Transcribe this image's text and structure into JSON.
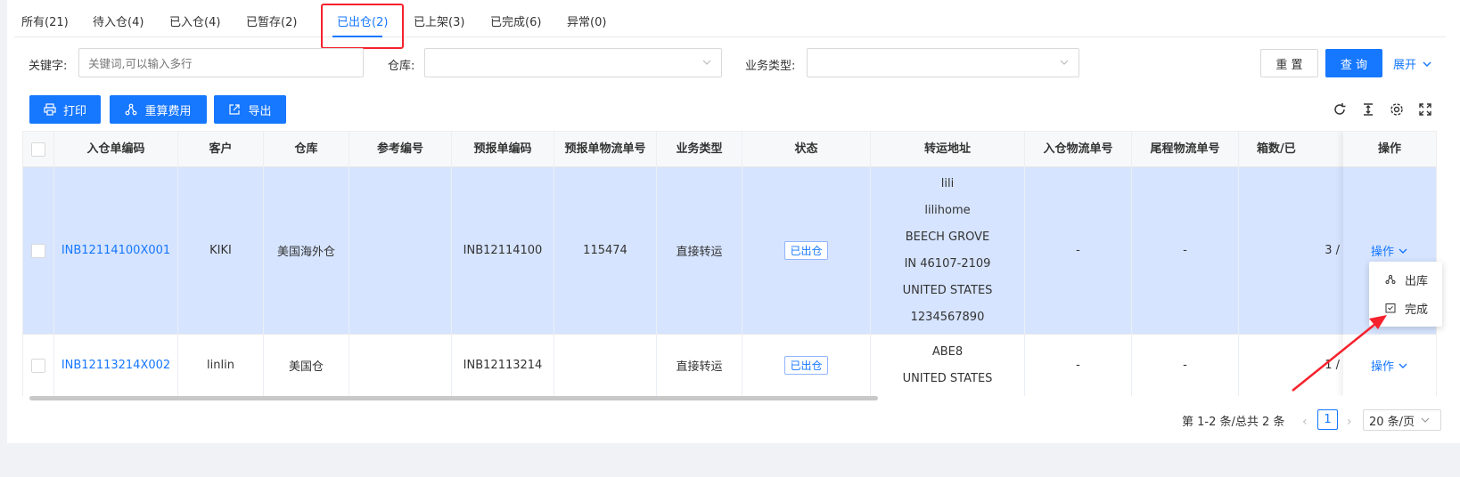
{
  "tabs": [
    {
      "label": "所有(21)"
    },
    {
      "label": "待入仓(4)"
    },
    {
      "label": "已入仓(4)"
    },
    {
      "label": "已暂存(2)"
    },
    {
      "label": "已出仓(2)"
    },
    {
      "label": "已上架(3)"
    },
    {
      "label": "已完成(6)"
    },
    {
      "label": "异常(0)"
    }
  ],
  "filters": {
    "keyword_label": "关键字:",
    "keyword_placeholder": "关键词,可以输入多行",
    "warehouse_label": "仓库:",
    "business_type_label": "业务类型:",
    "reset_label": "重 置",
    "query_label": "查 询",
    "expand_label": "展开"
  },
  "toolbar": {
    "print_label": "打印",
    "recalc_label": "重算费用",
    "export_label": "导出"
  },
  "table": {
    "columns": [
      "入仓单编码",
      "客户",
      "仓库",
      "参考编号",
      "预报单编码",
      "预报单物流单号",
      "业务类型",
      "状态",
      "转运地址",
      "入仓物流单号",
      "尾程物流单号",
      "箱数/已",
      "操作"
    ],
    "rows": [
      {
        "code": "INB12114100X001",
        "customer": "KIKI",
        "warehouse": "美国海外仓",
        "ref": "",
        "forecast_code": "INB12114100",
        "forecast_tracking": "115474",
        "business_type": "直接转运",
        "status": "已出仓",
        "address": [
          "lili",
          "lilihome",
          "BEECH GROVE",
          "IN 46107-2109",
          "UNITED STATES",
          "1234567890"
        ],
        "inbound_tracking": "-",
        "last_mile_tracking": "-",
        "boxes": "3 /",
        "op_label": "操作"
      },
      {
        "code": "INB12113214X002",
        "customer": "linlin",
        "warehouse": "美国仓",
        "ref": "",
        "forecast_code": "INB12113214",
        "forecast_tracking": "",
        "business_type": "直接转运",
        "status": "已出仓",
        "address": [
          "ABE8",
          "UNITED STATES"
        ],
        "inbound_tracking": "-",
        "last_mile_tracking": "-",
        "boxes": "1 /",
        "op_label": "操作"
      }
    ]
  },
  "op_menu": {
    "items": [
      {
        "label": "出库"
      },
      {
        "label": "完成"
      }
    ]
  },
  "pagination": {
    "total_text": "第 1-2 条/总共 2 条",
    "current_page": "1",
    "page_size": "20 条/页"
  },
  "colors": {
    "primary": "#1677ff",
    "selected_row": "#d6e4ff",
    "highlight": "#f5222d"
  }
}
